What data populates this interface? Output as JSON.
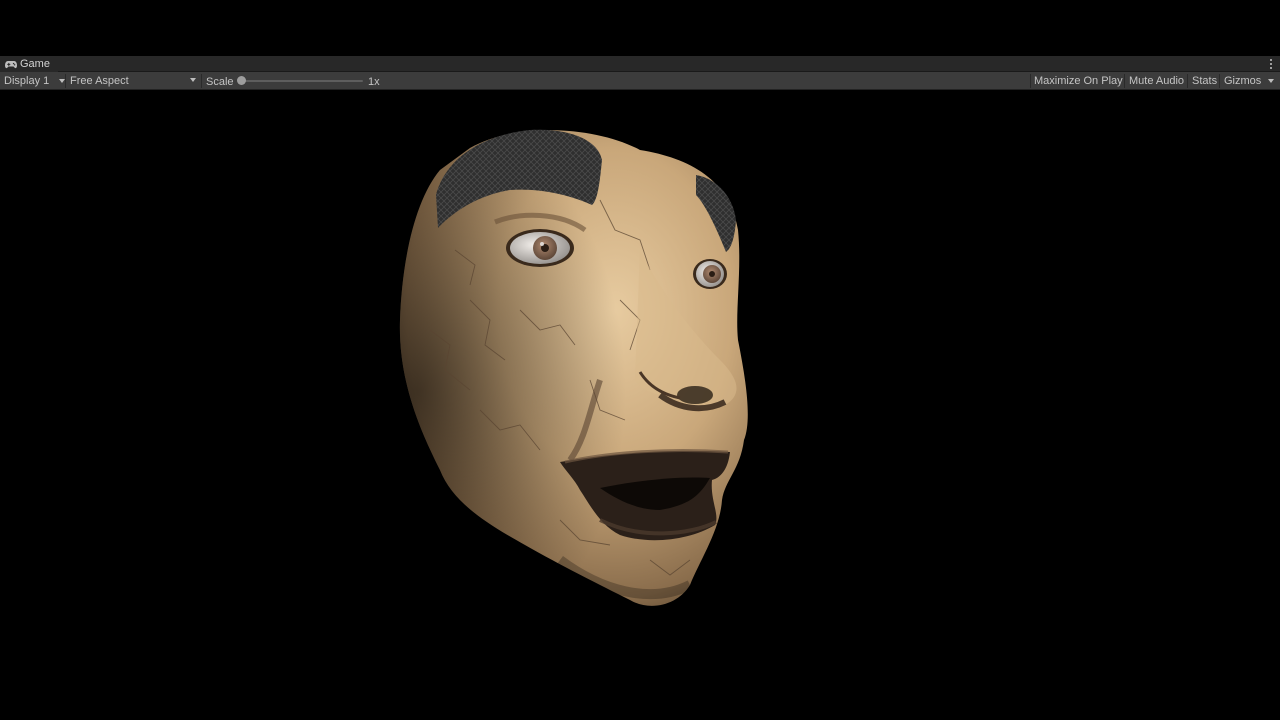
{
  "window": {
    "tab_title": "Game",
    "tab_icon": "gamepad-icon"
  },
  "toolbar": {
    "display_select": "Display 1",
    "aspect_select": "Free Aspect",
    "scale_label": "Scale",
    "scale_value": "1x",
    "scale_level": 0.0,
    "maximize_on_play": "Maximize On Play",
    "mute_audio": "Mute Audio",
    "stats": "Stats",
    "gizmos": "Gizmos"
  },
  "viewport": {
    "background": "#000000",
    "subject": "3d-face-model",
    "skin_color": "#c9a77a",
    "hair_color": "#2b2b2b"
  }
}
